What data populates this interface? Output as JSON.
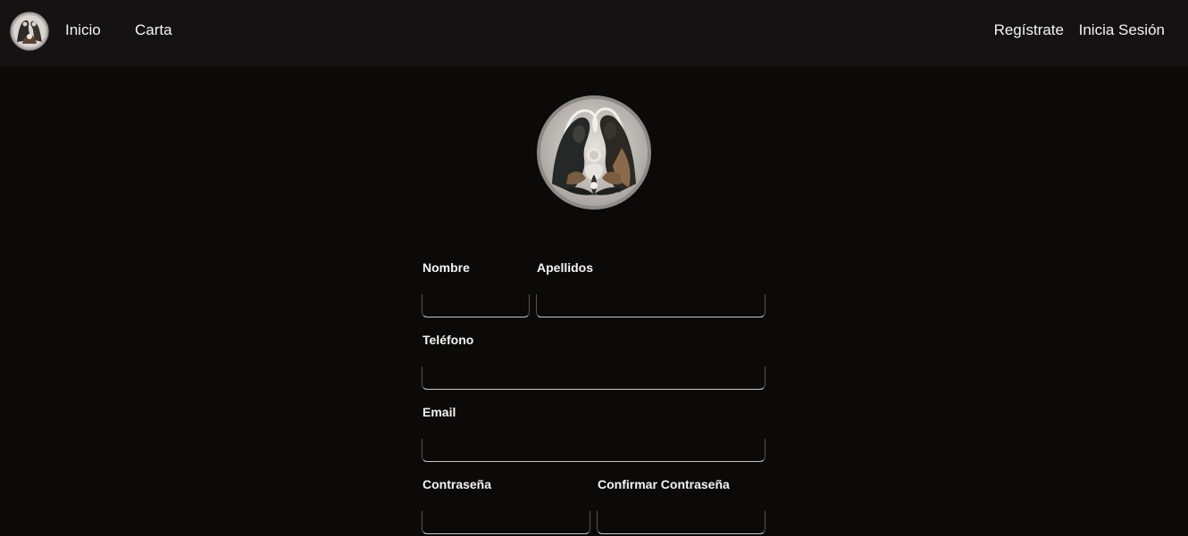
{
  "nav": {
    "logo_icon": "holy-family-logo-icon",
    "links": {
      "inicio": "Inicio",
      "carta": "Carta",
      "registrate": "Regístrate",
      "login": "Inicia Sesión"
    }
  },
  "hero": {
    "logo_icon": "holy-family-emblem-icon"
  },
  "form": {
    "nombre": {
      "label": "Nombre",
      "value": ""
    },
    "apellidos": {
      "label": "Apellidos",
      "value": ""
    },
    "telefono": {
      "label": "Teléfono",
      "value": ""
    },
    "email": {
      "label": "Email",
      "value": ""
    },
    "password": {
      "label": "Contraseña",
      "value": ""
    },
    "confirm_password": {
      "label": "Confirmar Contraseña",
      "value": ""
    }
  },
  "colors": {
    "background": "#0b0a09",
    "navbar": "#141213",
    "text": "#f4f4f4",
    "input_border": "#c9c9c9",
    "accent_brown": "#8a6a4a"
  }
}
